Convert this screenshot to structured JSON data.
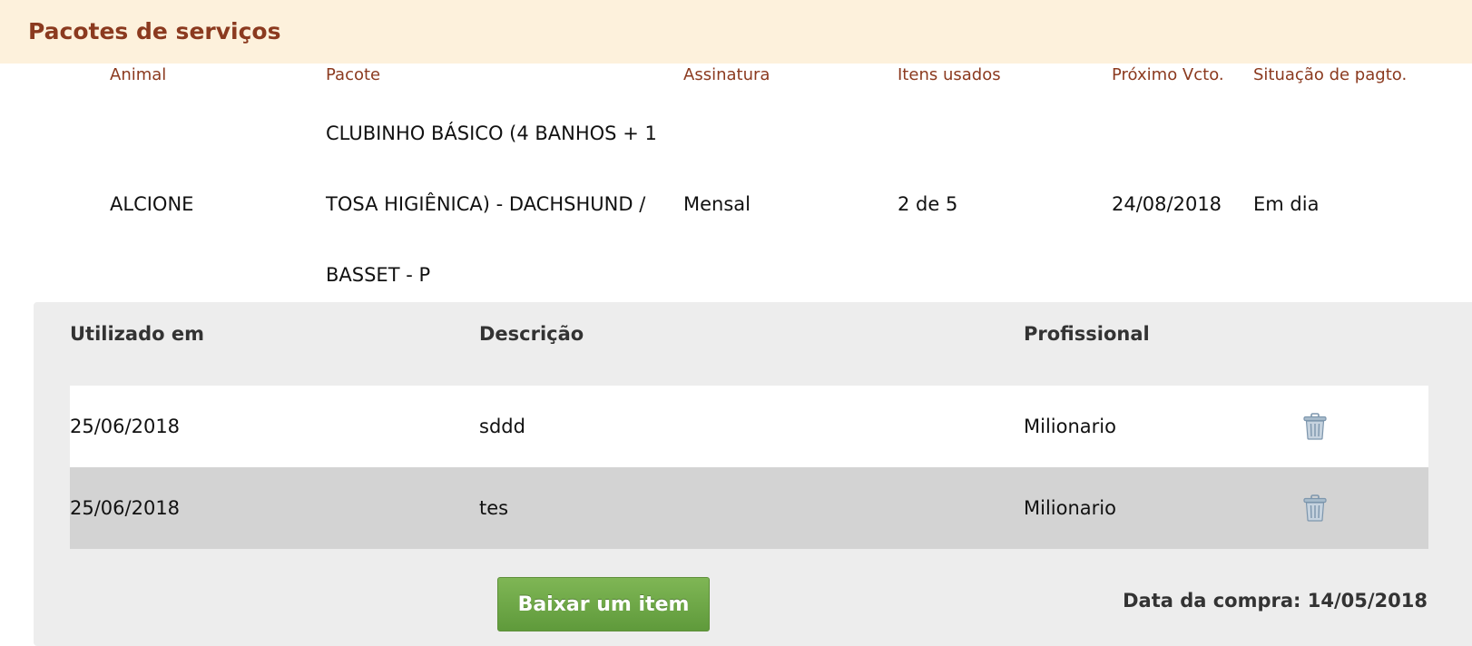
{
  "section": {
    "title": "Pacotes de serviços"
  },
  "subscription_table": {
    "headers": [
      "Animal",
      "Pacote",
      "Assinatura",
      "Itens usados",
      "Próximo Vcto.",
      "Situação de pagto."
    ],
    "row": {
      "animal": "ALCIONE",
      "package_lines": [
        "CLUBINHO BÁSICO (4 BANHOS + 1",
        "TOSA HIGIÊNICA) - DACHSHUND /",
        "BASSET - P"
      ],
      "subscription": "Mensal",
      "items_used": "2 de 5",
      "next_due": "24/08/2018",
      "payment_status": "Em dia"
    }
  },
  "usage_table": {
    "headers": [
      "Utilizado em",
      "Descrição",
      "Profissional"
    ],
    "rows": [
      {
        "date": "25/06/2018",
        "description": "sddd",
        "professional": "Milionario",
        "delete_icon": "trash-icon"
      },
      {
        "date": "25/06/2018",
        "description": "tes",
        "professional": "Milionario",
        "delete_icon": "trash-icon"
      }
    ],
    "row_colors": [
      "#ffffff",
      "#d3d3d3"
    ]
  },
  "actions": {
    "download_item_label": "Baixar um item"
  },
  "purchase": {
    "label": "Data da compra: 14/05/2018"
  },
  "colors": {
    "header_bg": "#fdf1dc",
    "accent": "#8b3a1f",
    "panel_bg": "#ededed",
    "button_green": "#6aa745"
  }
}
